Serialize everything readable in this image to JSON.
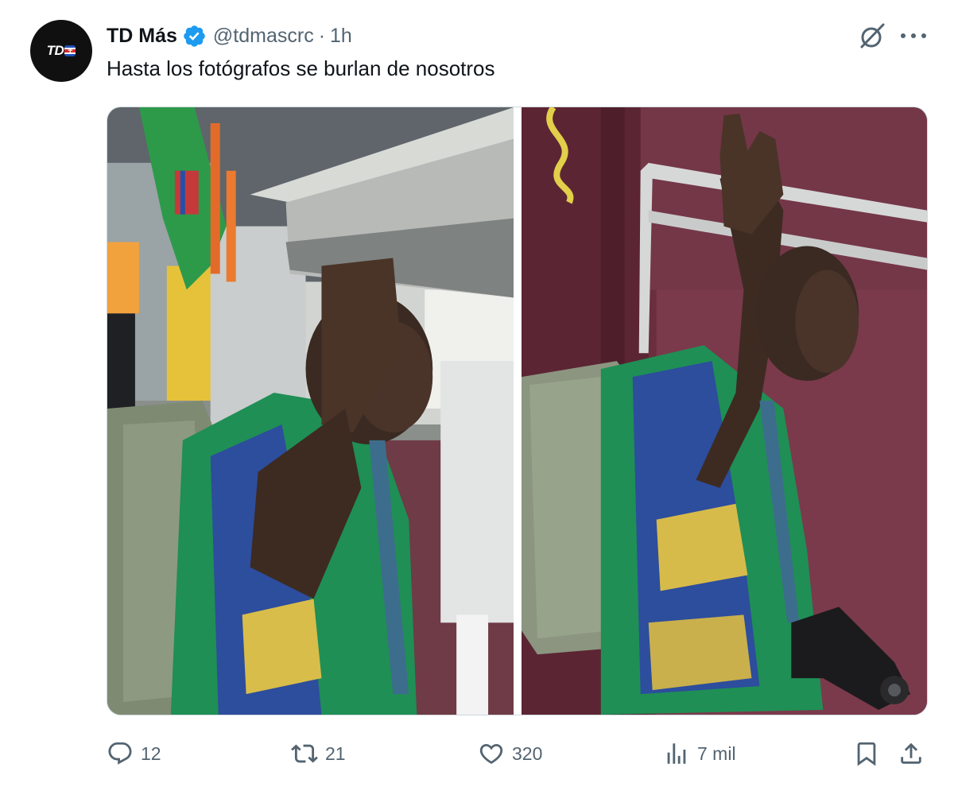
{
  "tweet": {
    "author": {
      "avatar_text": "TD",
      "avatar_flag": "+",
      "name": "TD Más",
      "handle": "@tdmascrc",
      "separator": "·",
      "time": "1h",
      "verified_color": "#1d9bf0"
    },
    "text": "Hasta los fotógrafos se burlan de nosotros",
    "media": [
      {
        "name": "photo-left",
        "icon": "photo"
      },
      {
        "name": "photo-right",
        "icon": "photo"
      }
    ],
    "actions": {
      "replies": "12",
      "reposts": "21",
      "likes": "320",
      "views": "7 mil"
    },
    "icons": [
      "grok-icon",
      "more-icon",
      "reply-icon",
      "repost-icon",
      "like-icon",
      "views-icon",
      "bookmark-icon",
      "share-icon"
    ],
    "colors": {
      "text": "#0f1419",
      "secondary": "#536471",
      "border": "#cfd9de"
    }
  }
}
